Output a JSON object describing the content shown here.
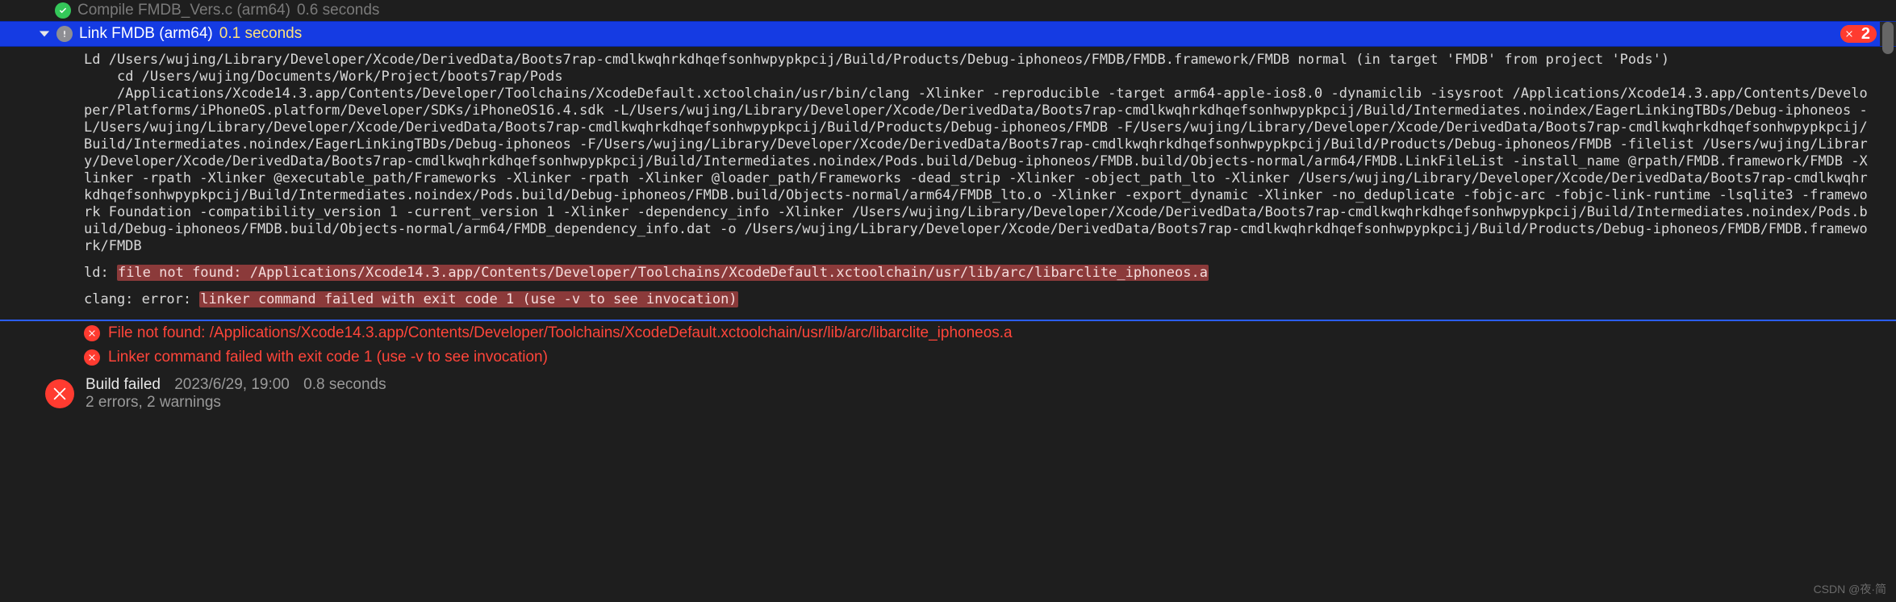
{
  "compile_row": {
    "title": "Compile FMDB_Vers.c (arm64)",
    "duration": "0.6 seconds"
  },
  "link_row": {
    "title": "Link FMDB (arm64)",
    "duration": "0.1 seconds",
    "error_count": "2"
  },
  "log_body": "Ld /Users/wujing/Library/Developer/Xcode/DerivedData/Boots7rap-cmdlkwqhrkdhqefsonhwpypkpcij/Build/Products/Debug-iphoneos/FMDB/FMDB.framework/FMDB normal (in target 'FMDB' from project 'Pods')\n    cd /Users/wujing/Documents/Work/Project/boots7rap/Pods\n    /Applications/Xcode14.3.app/Contents/Developer/Toolchains/XcodeDefault.xctoolchain/usr/bin/clang -Xlinker -reproducible -target arm64-apple-ios8.0 -dynamiclib -isysroot /Applications/Xcode14.3.app/Contents/Developer/Platforms/iPhoneOS.platform/Developer/SDKs/iPhoneOS16.4.sdk -L/Users/wujing/Library/Developer/Xcode/DerivedData/Boots7rap-cmdlkwqhrkdhqefsonhwpypkpcij/Build/Intermediates.noindex/EagerLinkingTBDs/Debug-iphoneos -L/Users/wujing/Library/Developer/Xcode/DerivedData/Boots7rap-cmdlkwqhrkdhqefsonhwpypkpcij/Build/Products/Debug-iphoneos/FMDB -F/Users/wujing/Library/Developer/Xcode/DerivedData/Boots7rap-cmdlkwqhrkdhqefsonhwpypkpcij/Build/Intermediates.noindex/EagerLinkingTBDs/Debug-iphoneos -F/Users/wujing/Library/Developer/Xcode/DerivedData/Boots7rap-cmdlkwqhrkdhqefsonhwpypkpcij/Build/Products/Debug-iphoneos/FMDB -filelist /Users/wujing/Library/Developer/Xcode/DerivedData/Boots7rap-cmdlkwqhrkdhqefsonhwpypkpcij/Build/Intermediates.noindex/Pods.build/Debug-iphoneos/FMDB.build/Objects-normal/arm64/FMDB.LinkFileList -install_name @rpath/FMDB.framework/FMDB -Xlinker -rpath -Xlinker @executable_path/Frameworks -Xlinker -rpath -Xlinker @loader_path/Frameworks -dead_strip -Xlinker -object_path_lto -Xlinker /Users/wujing/Library/Developer/Xcode/DerivedData/Boots7rap-cmdlkwqhrkdhqefsonhwpypkpcij/Build/Intermediates.noindex/Pods.build/Debug-iphoneos/FMDB.build/Objects-normal/arm64/FMDB_lto.o -Xlinker -export_dynamic -Xlinker -no_deduplicate -fobjc-arc -fobjc-link-runtime -lsqlite3 -framework Foundation -compatibility_version 1 -current_version 1 -Xlinker -dependency_info -Xlinker /Users/wujing/Library/Developer/Xcode/DerivedData/Boots7rap-cmdlkwqhrkdhqefsonhwpypkpcij/Build/Intermediates.noindex/Pods.build/Debug-iphoneos/FMDB.build/Objects-normal/arm64/FMDB_dependency_info.dat -o /Users/wujing/Library/Developer/Xcode/DerivedData/Boots7rap-cmdlkwqhrkdhqefsonhwpypkpcij/Build/Products/Debug-iphoneos/FMDB/FMDB.framework/FMDB",
  "ld_line": {
    "prefix": "ld: ",
    "highlight": "file not found: /Applications/Xcode14.3.app/Contents/Developer/Toolchains/XcodeDefault.xctoolchain/usr/lib/arc/libarclite_iphoneos.a"
  },
  "clang_line": {
    "prefix": "clang: error: ",
    "highlight": "linker command failed with exit code 1 (use -v to see invocation)"
  },
  "errors": [
    "File not found: /Applications/Xcode14.3.app/Contents/Developer/Toolchains/XcodeDefault.xctoolchain/usr/lib/arc/libarclite_iphoneos.a",
    "Linker command failed with exit code 1 (use -v to see invocation)"
  ],
  "footer": {
    "status": "Build failed",
    "timestamp": "2023/6/29, 19:00",
    "duration": "0.8 seconds",
    "counts": "2 errors, 2 warnings"
  },
  "watermark": "CSDN @夜·简"
}
